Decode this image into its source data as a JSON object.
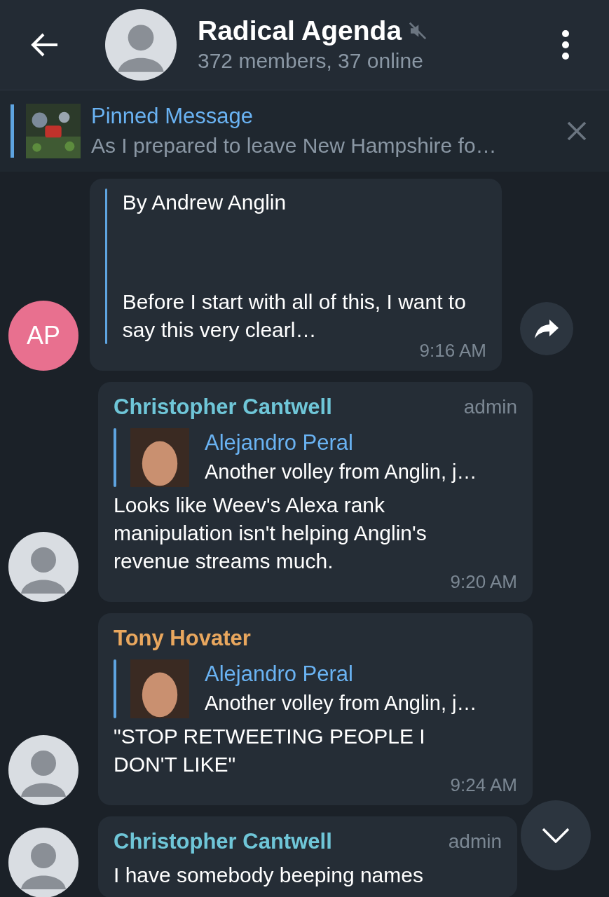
{
  "header": {
    "title": "Radical Agenda",
    "muted": true,
    "subtitle": "372 members, 37 online"
  },
  "pinned": {
    "title": "Pinned Message",
    "text": "As I prepared to leave New Hampshire fo…"
  },
  "messages": [
    {
      "avatar": {
        "kind": "initials",
        "initials": "AP",
        "color": "#e8708f"
      },
      "preview_top": "By Andrew Anglin",
      "preview_body": "Before I start with all of this, I want to say this very clearl…",
      "time": "9:16 AM",
      "share": true
    },
    {
      "sender": "Christopher Cantwell",
      "color": "#6fc6d8",
      "badge": "admin",
      "reply": {
        "name": "Alejandro Peral",
        "text": "Another volley from Anglin, j…"
      },
      "text": "Looks like Weev's Alexa rank manipulation isn't helping Anglin's revenue streams much.",
      "time": "9:20 AM",
      "share": false
    },
    {
      "sender": "Tony Hovater",
      "color": "#e9a75e",
      "reply": {
        "name": "Alejandro Peral",
        "text": "Another volley from Anglin, j…"
      },
      "text": "\"STOP RETWEETING PEOPLE I DON'T LIKE\"",
      "time": "9:24 AM",
      "share": false
    },
    {
      "sender": "Christopher Cantwell",
      "color": "#6fc6d8",
      "badge": "admin",
      "text": "I have somebody beeping names",
      "share": false
    }
  ]
}
